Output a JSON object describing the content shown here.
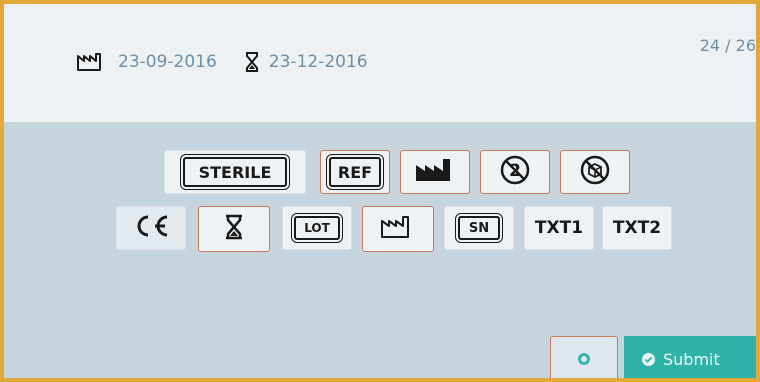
{
  "header": {
    "manufacture_date": "23-09-2016",
    "expiry_date": "23-12-2016",
    "page_counter": "24 / 26"
  },
  "symbols": {
    "row1": [
      {
        "id": "sterile",
        "label": "STERILE"
      },
      {
        "id": "ref",
        "label": "REF"
      },
      {
        "id": "manufacturer",
        "icon": "factory-icon"
      },
      {
        "id": "do-not-reuse",
        "icon": "do-not-reuse-icon"
      },
      {
        "id": "do-not-use-if-damaged",
        "icon": "do-not-use-if-damaged-icon"
      }
    ],
    "row2": [
      {
        "id": "ce",
        "label": "CE"
      },
      {
        "id": "use-by",
        "icon": "hourglass-icon"
      },
      {
        "id": "lot",
        "label": "LOT"
      },
      {
        "id": "date-of-manufacture",
        "icon": "factory-outline-icon"
      },
      {
        "id": "serial-number",
        "label": "SN"
      },
      {
        "id": "txt1",
        "label": "TXT1"
      },
      {
        "id": "txt2",
        "label": "TXT2"
      }
    ]
  },
  "actions": {
    "submit_label": "Submit"
  },
  "colors": {
    "accent_teal": "#2fb3a8",
    "text_blue_gray": "#6d8fa8",
    "border_orange": "#e2a93a",
    "selected_border": "#c77b5e"
  }
}
